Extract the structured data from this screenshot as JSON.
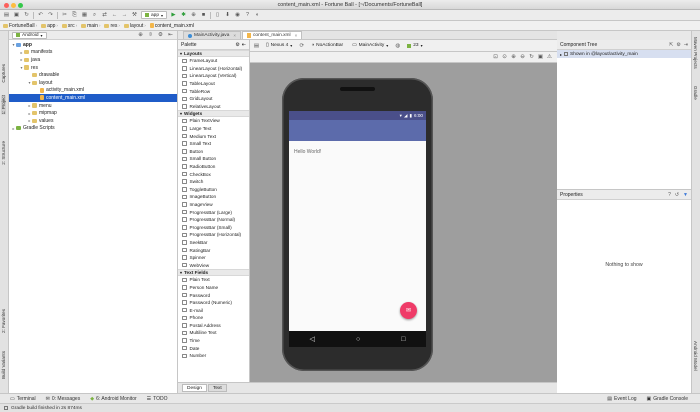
{
  "window": {
    "title": "content_main.xml - Fortune Ball - [~/Documents/FortuneBall]"
  },
  "toolbar": {
    "run_config": "app"
  },
  "breadcrumbs": [
    "FortuneBall",
    "app",
    "src",
    "main",
    "res",
    "layout",
    "content_main.xml"
  ],
  "left_tabs": [
    "1: Project",
    "Captures",
    "2: Structure",
    "2: Favorites",
    "Build Variants"
  ],
  "right_tabs": [
    "Maven Projects",
    "Gradle",
    "Android Model"
  ],
  "project": {
    "view_mode": "Android",
    "tree": [
      {
        "label": "app",
        "depth": 0,
        "kind": "module",
        "expanded": true,
        "bold": true
      },
      {
        "label": "manifests",
        "depth": 1,
        "kind": "folder",
        "expanded": false
      },
      {
        "label": "java",
        "depth": 1,
        "kind": "folder",
        "expanded": false
      },
      {
        "label": "res",
        "depth": 1,
        "kind": "folder",
        "expanded": true
      },
      {
        "label": "drawable",
        "depth": 2,
        "kind": "folder",
        "expanded": false,
        "leaf": true
      },
      {
        "label": "layout",
        "depth": 2,
        "kind": "folder",
        "expanded": true
      },
      {
        "label": "activity_main.xml",
        "depth": 3,
        "kind": "xml",
        "leaf": true
      },
      {
        "label": "content_main.xml",
        "depth": 3,
        "kind": "xml",
        "leaf": true,
        "selected": true
      },
      {
        "label": "menu",
        "depth": 2,
        "kind": "folder",
        "expanded": false
      },
      {
        "label": "mipmap",
        "depth": 2,
        "kind": "folder",
        "expanded": false
      },
      {
        "label": "values",
        "depth": 2,
        "kind": "folder",
        "expanded": false
      },
      {
        "label": "Gradle Scripts",
        "depth": 0,
        "kind": "gradle",
        "expanded": false
      }
    ]
  },
  "editor_tabs": [
    {
      "label": "MainActivity.java",
      "active": false
    },
    {
      "label": "content_main.xml",
      "active": true
    }
  ],
  "palette": {
    "title": "Palette",
    "categories": [
      {
        "name": "Layouts",
        "items": [
          "FrameLayout",
          "LinearLayout (Horizontal)",
          "LinearLayout (Vertical)",
          "TableLayout",
          "TableRow",
          "GridLayout",
          "RelativeLayout"
        ]
      },
      {
        "name": "Widgets",
        "items": [
          "Plain TextView",
          "Large Text",
          "Medium Text",
          "Small Text",
          "Button",
          "Small Button",
          "RadioButton",
          "CheckBox",
          "Switch",
          "ToggleButton",
          "ImageButton",
          "ImageView",
          "ProgressBar (Large)",
          "ProgressBar (Normal)",
          "ProgressBar (Small)",
          "ProgressBar (Horizontal)",
          "SeekBar",
          "RatingBar",
          "Spinner",
          "WebView"
        ]
      },
      {
        "name": "Text Fields",
        "items": [
          "Plain Text",
          "Person Name",
          "Password",
          "Password (Numeric)",
          "E-mail",
          "Phone",
          "Postal Address",
          "Multiline Text",
          "Time",
          "Date",
          "Number"
        ]
      }
    ]
  },
  "design_toolbar": {
    "device": "Nexus 4",
    "theme": "NoActionBar",
    "activity": "MainActivity",
    "api": "23"
  },
  "preview": {
    "time": "6:00",
    "hello_text": "Hello World!"
  },
  "design_tabs": [
    {
      "label": "Design",
      "active": true
    },
    {
      "label": "Text",
      "active": false
    }
  ],
  "component_tree": {
    "title": "Component Tree",
    "root": "Shown in @layout/activity_main"
  },
  "properties": {
    "title": "Properties",
    "empty_text": "Nothing to show"
  },
  "bottom_tools": [
    {
      "label": "Terminal",
      "icon": "terminal-icon"
    },
    {
      "label": "0: Messages",
      "icon": "messages-icon"
    },
    {
      "label": "6: Android Monitor",
      "icon": "android-icon"
    },
    {
      "label": "TODO",
      "icon": "todo-icon"
    }
  ],
  "bottom_right_tools": [
    {
      "label": "Event Log",
      "icon": "event-log-icon"
    },
    {
      "label": "Gradle Console",
      "icon": "gradle-console-icon"
    }
  ],
  "status": {
    "message": "Gradle build finished in 2s 874ms"
  },
  "colors": {
    "selection": "#1f5cc8",
    "primary": "#5c6bab",
    "primary_dark": "#4a4f8a",
    "accent": "#ef3b68"
  }
}
